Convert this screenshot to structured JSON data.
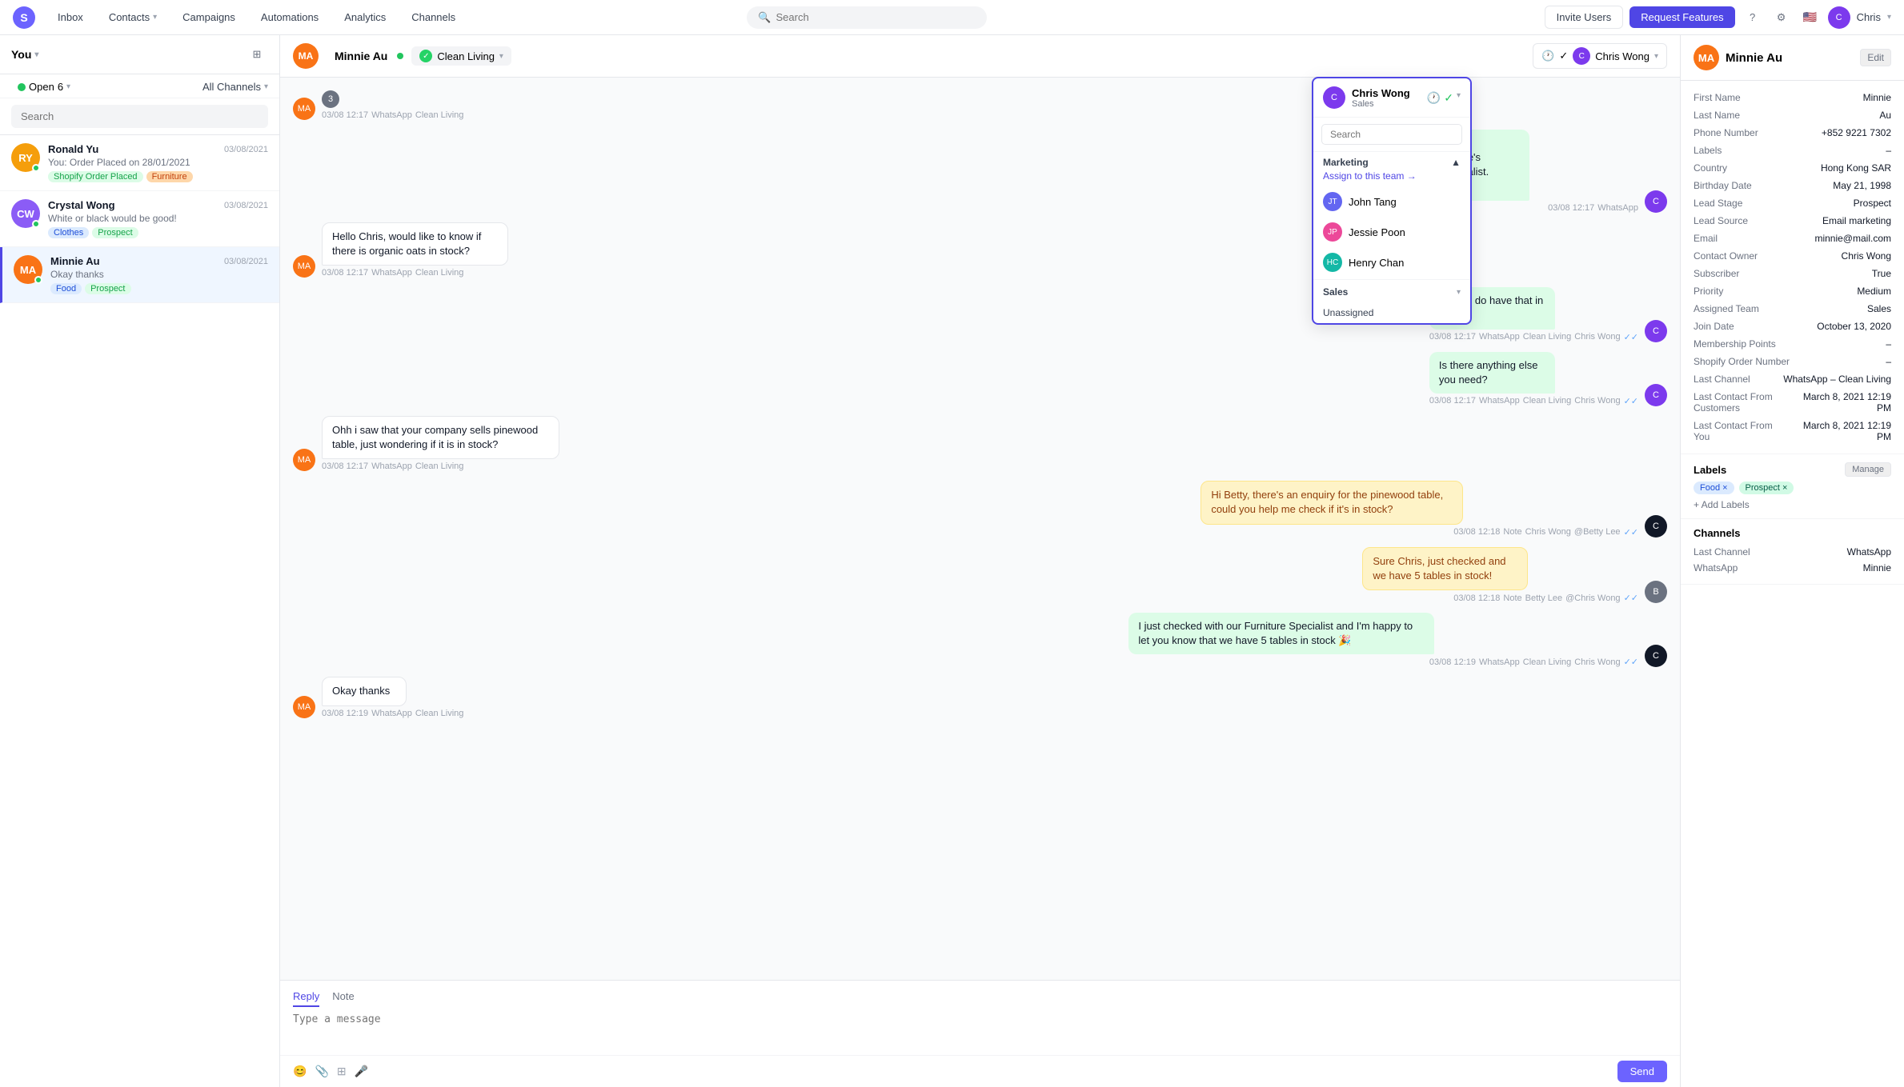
{
  "nav": {
    "logo_letter": "S",
    "items": [
      {
        "label": "Inbox",
        "id": "inbox"
      },
      {
        "label": "Contacts",
        "id": "contacts",
        "arrow": true
      },
      {
        "label": "Campaigns",
        "id": "campaigns"
      },
      {
        "label": "Automations",
        "id": "automations"
      },
      {
        "label": "Analytics",
        "id": "analytics"
      },
      {
        "label": "Channels",
        "id": "channels"
      }
    ],
    "search_placeholder": "Search",
    "invite_label": "Invite Users",
    "request_label": "Request Features",
    "user_name": "Chris"
  },
  "sidebar": {
    "you_label": "You",
    "open_label": "Open",
    "open_count": "6",
    "all_channels_label": "All Channels",
    "search_placeholder": "Search",
    "conversations": [
      {
        "id": "ronald",
        "name": "Ronald Yu",
        "preview": "You: Order Placed on 28/01/2021",
        "date": "03/08/2021",
        "tags": [
          {
            "label": "Shopify Order Placed",
            "color": "green"
          },
          {
            "label": "Furniture",
            "color": "orange"
          }
        ],
        "avatar_bg": "#f59e0b",
        "initials": "RY"
      },
      {
        "id": "crystal",
        "name": "Crystal Wong",
        "preview": "White or black would be good!",
        "date": "03/08/2021",
        "tags": [
          {
            "label": "Clothes",
            "color": "blue"
          },
          {
            "label": "Prospect",
            "color": "green"
          }
        ],
        "avatar_bg": "#8b5cf6",
        "initials": "CW"
      },
      {
        "id": "minnie",
        "name": "Minnie Au",
        "preview": "Okay thanks",
        "date": "03/08/2021",
        "tags": [
          {
            "label": "Food",
            "color": "blue"
          },
          {
            "label": "Prospect",
            "color": "green"
          }
        ],
        "avatar_bg": "#f97316",
        "initials": "MA",
        "active": true
      }
    ]
  },
  "chat": {
    "contact_name": "Minnie Au",
    "channel_name": "Clean Living",
    "reply_tab": "Reply",
    "note_tab": "Note",
    "reply_placeholder": "Type a message",
    "send_label": "Send",
    "messages": [
      {
        "id": "m1",
        "type": "incoming",
        "number_badge": "3",
        "time": "03/08 12:17",
        "channel": "WhatsApp",
        "source": "Clean Living"
      },
      {
        "id": "m2",
        "type": "outgoing",
        "text": "Hi Minnie!\nI'm Chris, Simple Life's Organic Food Specialist. How...",
        "time": "03/08 12:17",
        "channel": "WhatsApp",
        "source": ""
      },
      {
        "id": "m3",
        "type": "incoming",
        "text": "Hello Chris, would like to know if there is organic oats in stock?",
        "time": "03/08 12:17",
        "channel": "WhatsApp",
        "source": "Clean Living"
      },
      {
        "id": "m4",
        "type": "outgoing",
        "text": "Yes we do have that in stock!",
        "time": "03/08 12:17",
        "channel": "WhatsApp",
        "source": "Clean Living",
        "agent": "Chris Wong"
      },
      {
        "id": "m5",
        "type": "outgoing",
        "text": "Is there anything else you need?",
        "time": "03/08 12:17",
        "channel": "WhatsApp",
        "source": "Clean Living",
        "agent": "Chris Wong"
      },
      {
        "id": "m6",
        "type": "incoming",
        "text": "Ohh i saw that your company sells pinewood table, just wondering if it is in stock?",
        "time": "03/08 12:17",
        "channel": "WhatsApp",
        "source": "Clean Living"
      },
      {
        "id": "m7",
        "type": "note",
        "text": "Hi Betty, there's an enquiry for the pinewood table, could you help me check if it's in stock?",
        "time": "03/08 12:18",
        "channel": "Note",
        "agent": "Chris Wong",
        "mention": "@Betty Lee"
      },
      {
        "id": "m8",
        "type": "note-reply",
        "text": "Sure Chris, just checked and we have 5 tables in stock!",
        "time": "03/08 12:18",
        "channel": "Note",
        "agent": "Betty Lee",
        "mention": "@Chris Wong"
      },
      {
        "id": "m9",
        "type": "outgoing",
        "text": "I just checked with our Furniture Specialist and I'm happy to let you know that we have 5 tables in stock 🎉",
        "time": "03/08 12:19",
        "channel": "WhatsApp",
        "source": "Clean Living",
        "agent": "Chris Wong"
      },
      {
        "id": "m10",
        "type": "incoming",
        "text": "Okay thanks",
        "time": "03/08 12:19",
        "channel": "WhatsApp",
        "source": "Clean Living"
      }
    ]
  },
  "dropdown": {
    "agent_name": "Chris Wong",
    "agent_role": "Sales",
    "search_placeholder": "Search",
    "marketing_label": "Marketing",
    "assign_team_label": "Assign to this team →",
    "agents_marketing": [
      {
        "name": "John Tang",
        "initials": "JT"
      },
      {
        "name": "Jessie Poon",
        "initials": "JP"
      },
      {
        "name": "Henry Chan",
        "initials": "HC"
      }
    ],
    "sales_label": "Sales",
    "unassigned_label": "Unassigned"
  },
  "right_panel": {
    "contact_name": "Minnie Au",
    "initials": "MA",
    "edit_label": "Edit",
    "fields": [
      {
        "label": "First Name",
        "value": "Minnie"
      },
      {
        "label": "Last Name",
        "value": "Au"
      },
      {
        "label": "Phone Number",
        "value": "+852 9221 7302"
      },
      {
        "label": "Labels",
        "value": "–"
      },
      {
        "label": "Country",
        "value": "Hong Kong SAR"
      },
      {
        "label": "Birthday Date",
        "value": "May 21, 1998"
      },
      {
        "label": "Lead Stage",
        "value": "Prospect"
      },
      {
        "label": "Lead Source",
        "value": "Email marketing"
      },
      {
        "label": "Email",
        "value": "minnie@mail.com"
      },
      {
        "label": "Contact Owner",
        "value": "Chris Wong"
      },
      {
        "label": "Subscriber",
        "value": "True"
      },
      {
        "label": "Priority",
        "value": "Medium"
      },
      {
        "label": "Assigned Team",
        "value": "Sales"
      },
      {
        "label": "Join Date",
        "value": "October 13, 2020"
      },
      {
        "label": "Membership Points",
        "value": "–"
      },
      {
        "label": "Shopify Order Number",
        "value": "–"
      },
      {
        "label": "Last Channel",
        "value": "WhatsApp – Clean Living"
      },
      {
        "label": "Last Contact From Customers",
        "value": "March 8, 2021 12:19 PM"
      },
      {
        "label": "Last Contact From You",
        "value": "March 8, 2021 12:19 PM"
      }
    ],
    "labels_section_title": "Labels",
    "manage_label": "Manage",
    "labels": [
      {
        "label": "Food",
        "type": "food"
      },
      {
        "label": "Prospect",
        "type": "prospect"
      }
    ],
    "add_label_text": "+ Add Labels",
    "channels_section_title": "Channels",
    "channels": [
      {
        "label": "Last Channel",
        "value": "WhatsApp"
      },
      {
        "label": "WhatsApp",
        "value": "Minnie"
      }
    ]
  }
}
